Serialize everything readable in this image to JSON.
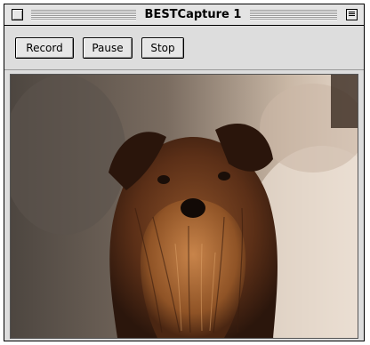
{
  "window": {
    "title": "BESTCapture 1"
  },
  "toolbar": {
    "record_label": "Record",
    "pause_label": "Pause",
    "stop_label": "Stop"
  },
  "video": {
    "subject": "dog-photo"
  },
  "icons": {
    "close": "close-box-icon",
    "zoom": "zoom-box-icon"
  }
}
